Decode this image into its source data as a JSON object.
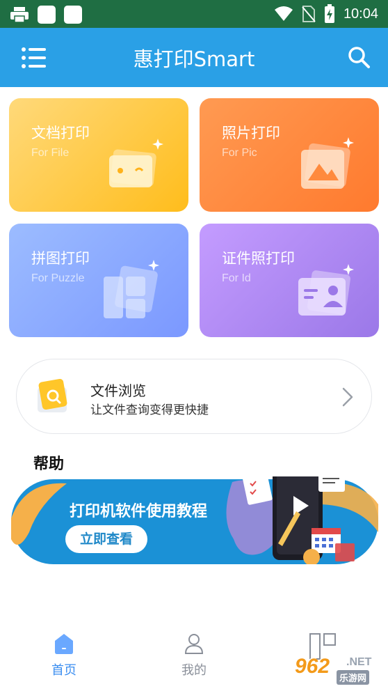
{
  "statusbar": {
    "time": "10:04"
  },
  "appbar": {
    "title": "惠打印Smart",
    "menu_icon": "menu-list-icon",
    "search_icon": "search-icon"
  },
  "cards": [
    {
      "title": "文档打印",
      "subtitle": "For File",
      "icon": "folder-icon"
    },
    {
      "title": "照片打印",
      "subtitle": "For Pic",
      "icon": "photo-icon"
    },
    {
      "title": "拼图打印",
      "subtitle": "For Puzzle",
      "icon": "puzzle-grid-icon"
    },
    {
      "title": "证件照打印",
      "subtitle": "For Id",
      "icon": "id-card-icon"
    }
  ],
  "browse": {
    "title": "文件浏览",
    "subtitle": "让文件查询变得更快捷"
  },
  "help": {
    "title": "帮助",
    "banner_text": "打印机软件使用教程",
    "banner_button": "立即查看"
  },
  "tabs": [
    {
      "label": "首页",
      "active": true
    },
    {
      "label": "我的",
      "active": false
    },
    {
      "label": "",
      "active": false
    }
  ],
  "watermark": {
    "num": "962",
    "net": ".NET",
    "cn": "乐游网"
  },
  "colors": {
    "appbar": "#2aa0e6",
    "statusbar": "#1f6e43",
    "tab_active": "#3a8df0",
    "tab_inactive": "#8a8f99"
  }
}
